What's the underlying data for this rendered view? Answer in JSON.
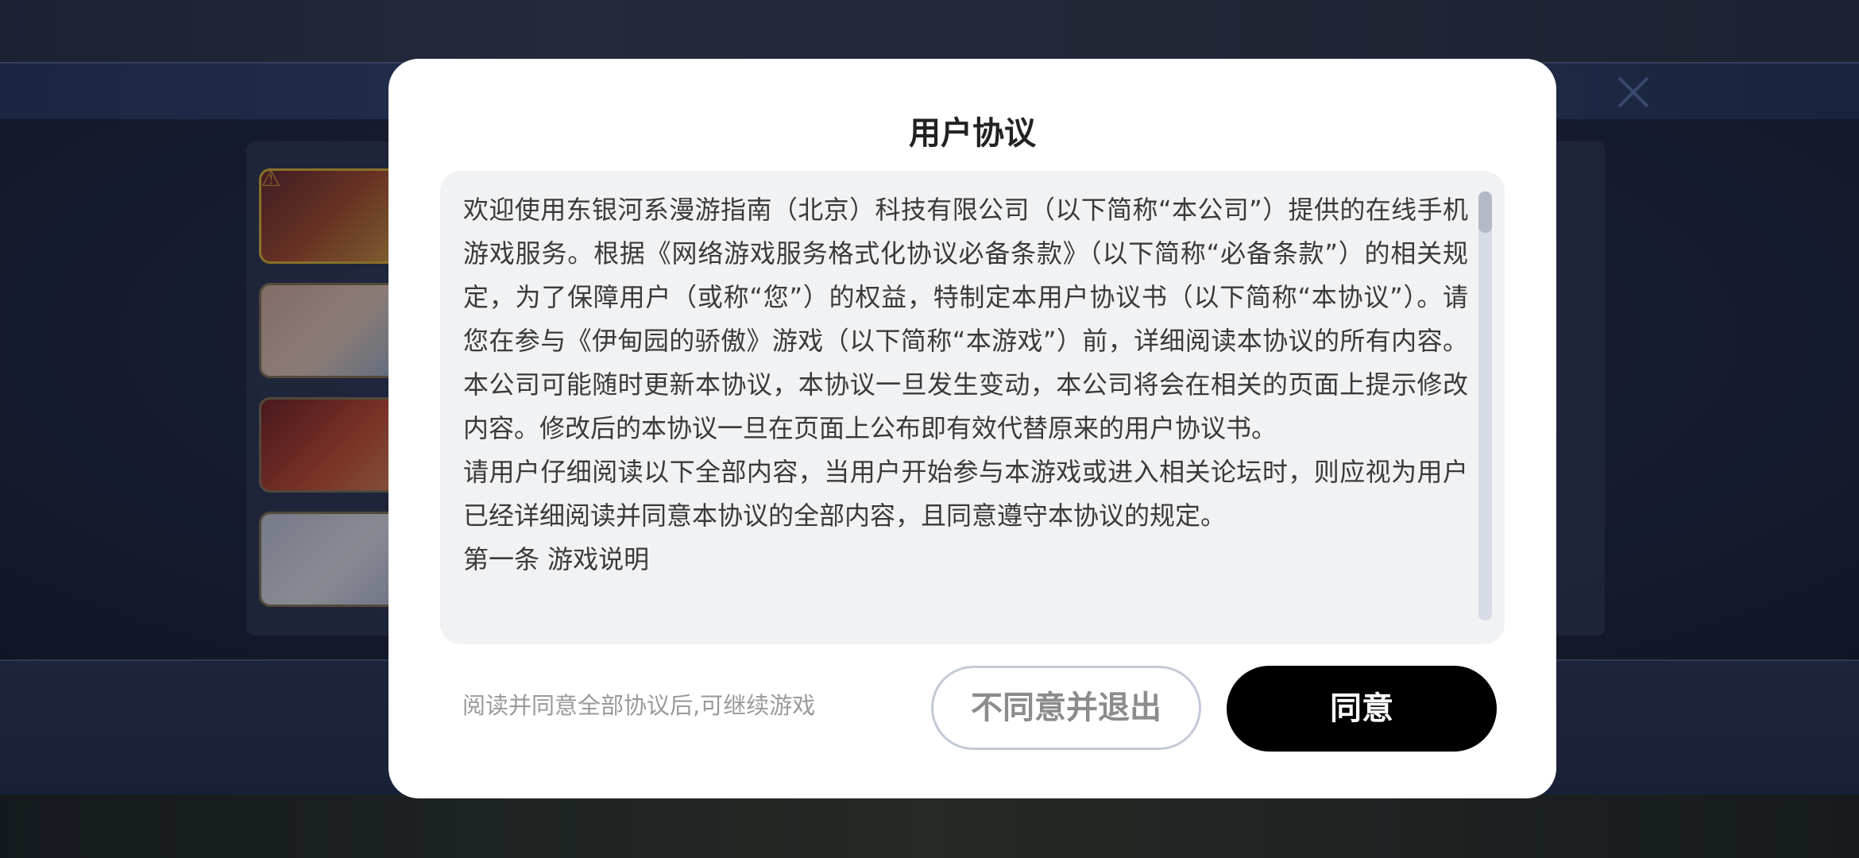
{
  "dialog": {
    "title": "用户协议",
    "paragraphs": [
      "欢迎使用东银河系漫游指南（北京）科技有限公司（以下简称“本公司”）提供的在线手机游戏服务。根据《网络游戏服务格式化协议必备条款》（以下简称“必备条款”）的相关规定，为了保障用户（或称“您”）的权益，特制定本用户协议书（以下简称“本协议”）。请您在参与《伊甸园的骄傲》游戏（以下简称“本游戏”）前，详细阅读本协议的所有内容。本公司可能随时更新本协议，本协议一旦发生变动，本公司将会在相关的页面上提示修改内容。修改后的本协议一旦在页面上公布即有效代替原来的用户协议书。",
      "请用户仔细阅读以下全部内容，当用户开始参与本游戏或进入相关论坛时，则应视为用户已经详细阅读并同意本协议的全部内容，且同意遵守本协议的规定。",
      "第一条 游戏说明"
    ],
    "hint": "阅读并同意全部协议后,可继续游戏",
    "disagree_label": "不同意并退出",
    "agree_label": "同意"
  },
  "background": {
    "icons": [
      "warning-icon",
      "close-icon"
    ]
  },
  "colors": {
    "agree_button": "#000000",
    "disagree_border": "#c3c9d8",
    "content_bg": "#f1f2f4",
    "dialog_bg": "#ffffff"
  }
}
